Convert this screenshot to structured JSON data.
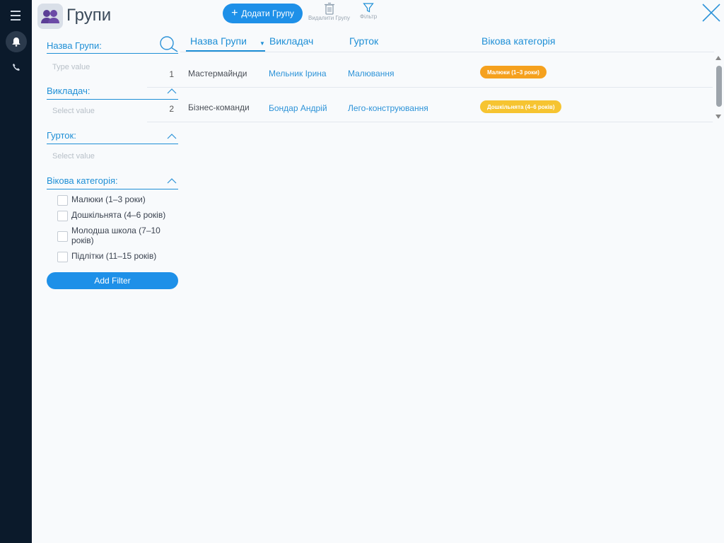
{
  "sidebar": {
    "icons": [
      "menu-icon",
      "bell-icon",
      "phone-icon"
    ],
    "colors": {
      "background": "#0b1a2b"
    }
  },
  "header": {
    "title": "Групи",
    "add_button": "Додати Групу",
    "delete_label": "Видалити Групу",
    "filter_label": "Фільтр"
  },
  "filters": {
    "group_name": {
      "label": "Назва Групи:",
      "placeholder": "Type value"
    },
    "teacher": {
      "label": "Викладач:",
      "placeholder": "Select value"
    },
    "club": {
      "label": "Гурток:",
      "placeholder": "Select value"
    },
    "age": {
      "label": "Вікова категорія:",
      "options": [
        {
          "label": "Малюки (1–3 роки)",
          "checked": false
        },
        {
          "label": "Дошкільнята (4–6 років)",
          "checked": false
        },
        {
          "label": "Молодша школа (7–10 років)",
          "checked": false
        },
        {
          "label": "Підлітки (11–15 років)",
          "checked": false
        }
      ]
    },
    "add_filter": "Add Filter"
  },
  "table": {
    "columns": [
      "Назва Групи",
      "Викладач",
      "Гурток",
      "Вікова категорія"
    ],
    "rows": [
      {
        "num": "1",
        "name": "Мастермайнди",
        "teacher": "Мельник Ірина",
        "club": "Малювання",
        "age": "Малюки (1–3 роки)",
        "age_color": "#f5a11e"
      },
      {
        "num": "2",
        "name": "Бізнес-команди",
        "teacher": "Бондар Андрій",
        "club": "Лего-конструювання",
        "age": "Дошкільнята (4–6 років)",
        "age_color": "#f6c431"
      }
    ]
  },
  "colors": {
    "accent": "#1e90e8",
    "link": "#2d93d8"
  }
}
